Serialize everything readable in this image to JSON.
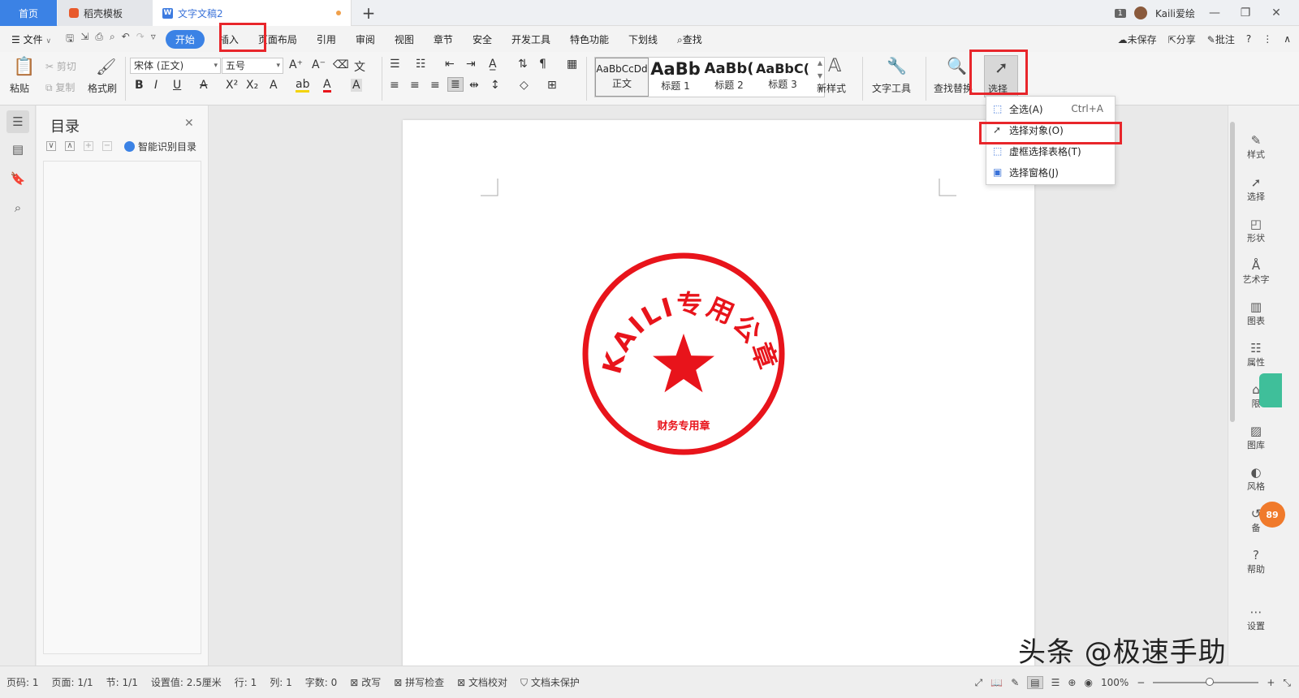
{
  "tabs": {
    "home": "首页",
    "template": "稻壳模板",
    "document": "文字文稿2",
    "add": "+"
  },
  "titlebar": {
    "window_count": "1",
    "user": "Kaili爱绘",
    "minimize": "—",
    "restore": "❐",
    "close": "✕"
  },
  "menu": {
    "file": "文件",
    "items": [
      "开始",
      "插入",
      "页面布局",
      "引用",
      "审阅",
      "视图",
      "章节",
      "安全",
      "开发工具",
      "特色功能",
      "下划线"
    ],
    "search": "查找",
    "unsaved": "未保存",
    "share": "分享",
    "comment": "批注",
    "help": "?"
  },
  "ribbon": {
    "paste": "粘贴",
    "cut": "剪切",
    "copy": "复制",
    "format_painter": "格式刷",
    "font_name": "宋体 (正文)",
    "font_size": "五号",
    "styles": [
      {
        "sample": "AaBbCcDd",
        "label": "正文"
      },
      {
        "sample": "AaBb",
        "label": "标题 1"
      },
      {
        "sample": "AaBb(",
        "label": "标题 2"
      },
      {
        "sample": "AaBbC(",
        "label": "标题 3"
      }
    ],
    "new_style": "新样式",
    "text_tools": "文字工具",
    "find_replace": "查找替换",
    "select": "选择"
  },
  "select_menu": {
    "items": [
      {
        "label": "全选(A)",
        "shortcut": "Ctrl+A"
      },
      {
        "label": "选择对象(O)",
        "shortcut": ""
      },
      {
        "label": "虚框选择表格(T)",
        "shortcut": ""
      },
      {
        "label": "选择窗格(J)",
        "shortcut": ""
      }
    ]
  },
  "toc": {
    "title": "目录",
    "smart": "智能识别目录"
  },
  "stamp": {
    "arc_text": "KAILI专用公章",
    "bottom_text": "财务专用章",
    "color": "#e8141b"
  },
  "right_tools": [
    "样式",
    "选择",
    "形状",
    "艺术字",
    "图表",
    "属性",
    "限",
    "图库",
    "风格",
    "备",
    "帮助",
    "设置"
  ],
  "float_badge": "89",
  "status": {
    "page": "页码: 1",
    "pages": "页面: 1/1",
    "section": "节: 1/1",
    "setting": "设置值: 2.5厘米",
    "row": "行: 1",
    "col": "列: 1",
    "words": "字数: 0",
    "revise": "改写",
    "spell": "拼写检查",
    "proof": "文档校对",
    "protect": "文档未保护",
    "zoom": "100%"
  },
  "watermark": "头条 @极速手助",
  "colors": {
    "accent": "#3b82e5",
    "highlight_box": "#e8262b"
  }
}
